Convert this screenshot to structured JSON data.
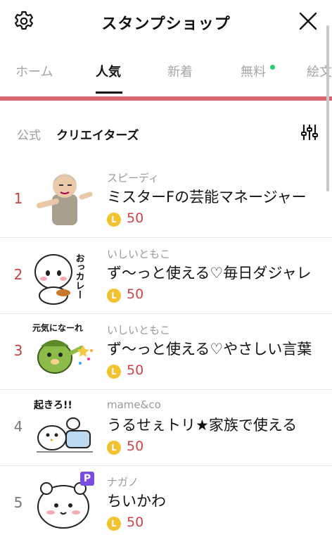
{
  "header": {
    "title": "スタンプショップ"
  },
  "tabs": [
    {
      "label": "ホーム"
    },
    {
      "label": "人気"
    },
    {
      "label": "新着"
    },
    {
      "label": "無料"
    },
    {
      "label": "絵文"
    }
  ],
  "active_tab": "人気",
  "colors": {
    "accent": "#d9676f",
    "new_dot": "#2ecc71",
    "rank_hot": "#c24340",
    "price": "#d0454b",
    "coin": "#f2c230"
  },
  "subnav": {
    "official": "公式",
    "creators": "クリエイターズ"
  },
  "items": [
    {
      "rank": "1",
      "author": "スピーディ",
      "name": "ミスターFの芸能マネージャー",
      "coin": "L",
      "price": "50"
    },
    {
      "rank": "2",
      "author": "いしいともこ",
      "name": "ず〜っと使える♡毎日ダジャレ",
      "coin": "L",
      "price": "50",
      "sticker_text": "おっカレー"
    },
    {
      "rank": "3",
      "author": "いしいともこ",
      "name": "ず〜っと使える♡やさしい言葉",
      "coin": "L",
      "price": "50",
      "sticker_text": "元気になーれ"
    },
    {
      "rank": "4",
      "author": "mame&co",
      "name": "うるせぇトリ★家族で使える",
      "coin": "L",
      "price": "50",
      "sticker_text": "起きろ!!"
    },
    {
      "rank": "5",
      "author": "ナガノ",
      "name": "ちいかわ",
      "coin": "L",
      "price": "50",
      "badge": "P"
    }
  ]
}
